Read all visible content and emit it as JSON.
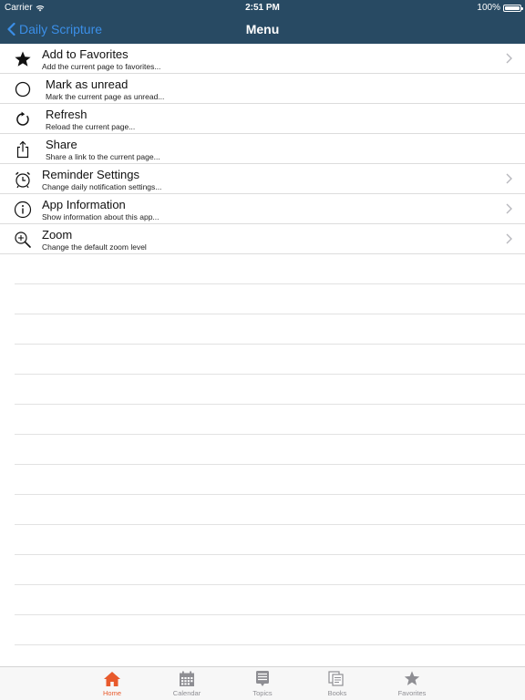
{
  "status_bar": {
    "carrier": "Carrier",
    "time": "2:51 PM",
    "battery": "100%"
  },
  "nav": {
    "back_label": "Daily Scripture",
    "title": "Menu"
  },
  "menu": [
    {
      "title": "Add to Favorites",
      "subtitle": "Add the current page to favorites...",
      "icon": "star-icon",
      "chevron": true
    },
    {
      "title": "Mark as unread",
      "subtitle": "Mark the current page as unread...",
      "icon": "circle-icon",
      "chevron": false
    },
    {
      "title": "Refresh",
      "subtitle": "Reload the current page...",
      "icon": "refresh-icon",
      "chevron": false
    },
    {
      "title": "Share",
      "subtitle": "Share a link to the current page...",
      "icon": "share-icon",
      "chevron": false
    },
    {
      "title": "Reminder Settings",
      "subtitle": "Change daily notification settings...",
      "icon": "alarm-clock-icon",
      "chevron": true
    },
    {
      "title": "App Information",
      "subtitle": "Show information about this app...",
      "icon": "info-icon",
      "chevron": true
    },
    {
      "title": "Zoom",
      "subtitle": "Change the default zoom level",
      "icon": "zoom-icon",
      "chevron": true
    }
  ],
  "tabs": [
    {
      "label": "Home",
      "icon": "home-icon",
      "active": true
    },
    {
      "label": "Calendar",
      "icon": "calendar-icon",
      "active": false
    },
    {
      "label": "Topics",
      "icon": "topics-icon",
      "active": false
    },
    {
      "label": "Books",
      "icon": "books-icon",
      "active": false
    },
    {
      "label": "Favorites",
      "icon": "star-icon",
      "active": false
    }
  ],
  "colors": {
    "nav_background": "#284a63",
    "back_link": "#3b8fe8",
    "tab_active": "#e85a2c",
    "tab_inactive": "#8e8e93"
  }
}
